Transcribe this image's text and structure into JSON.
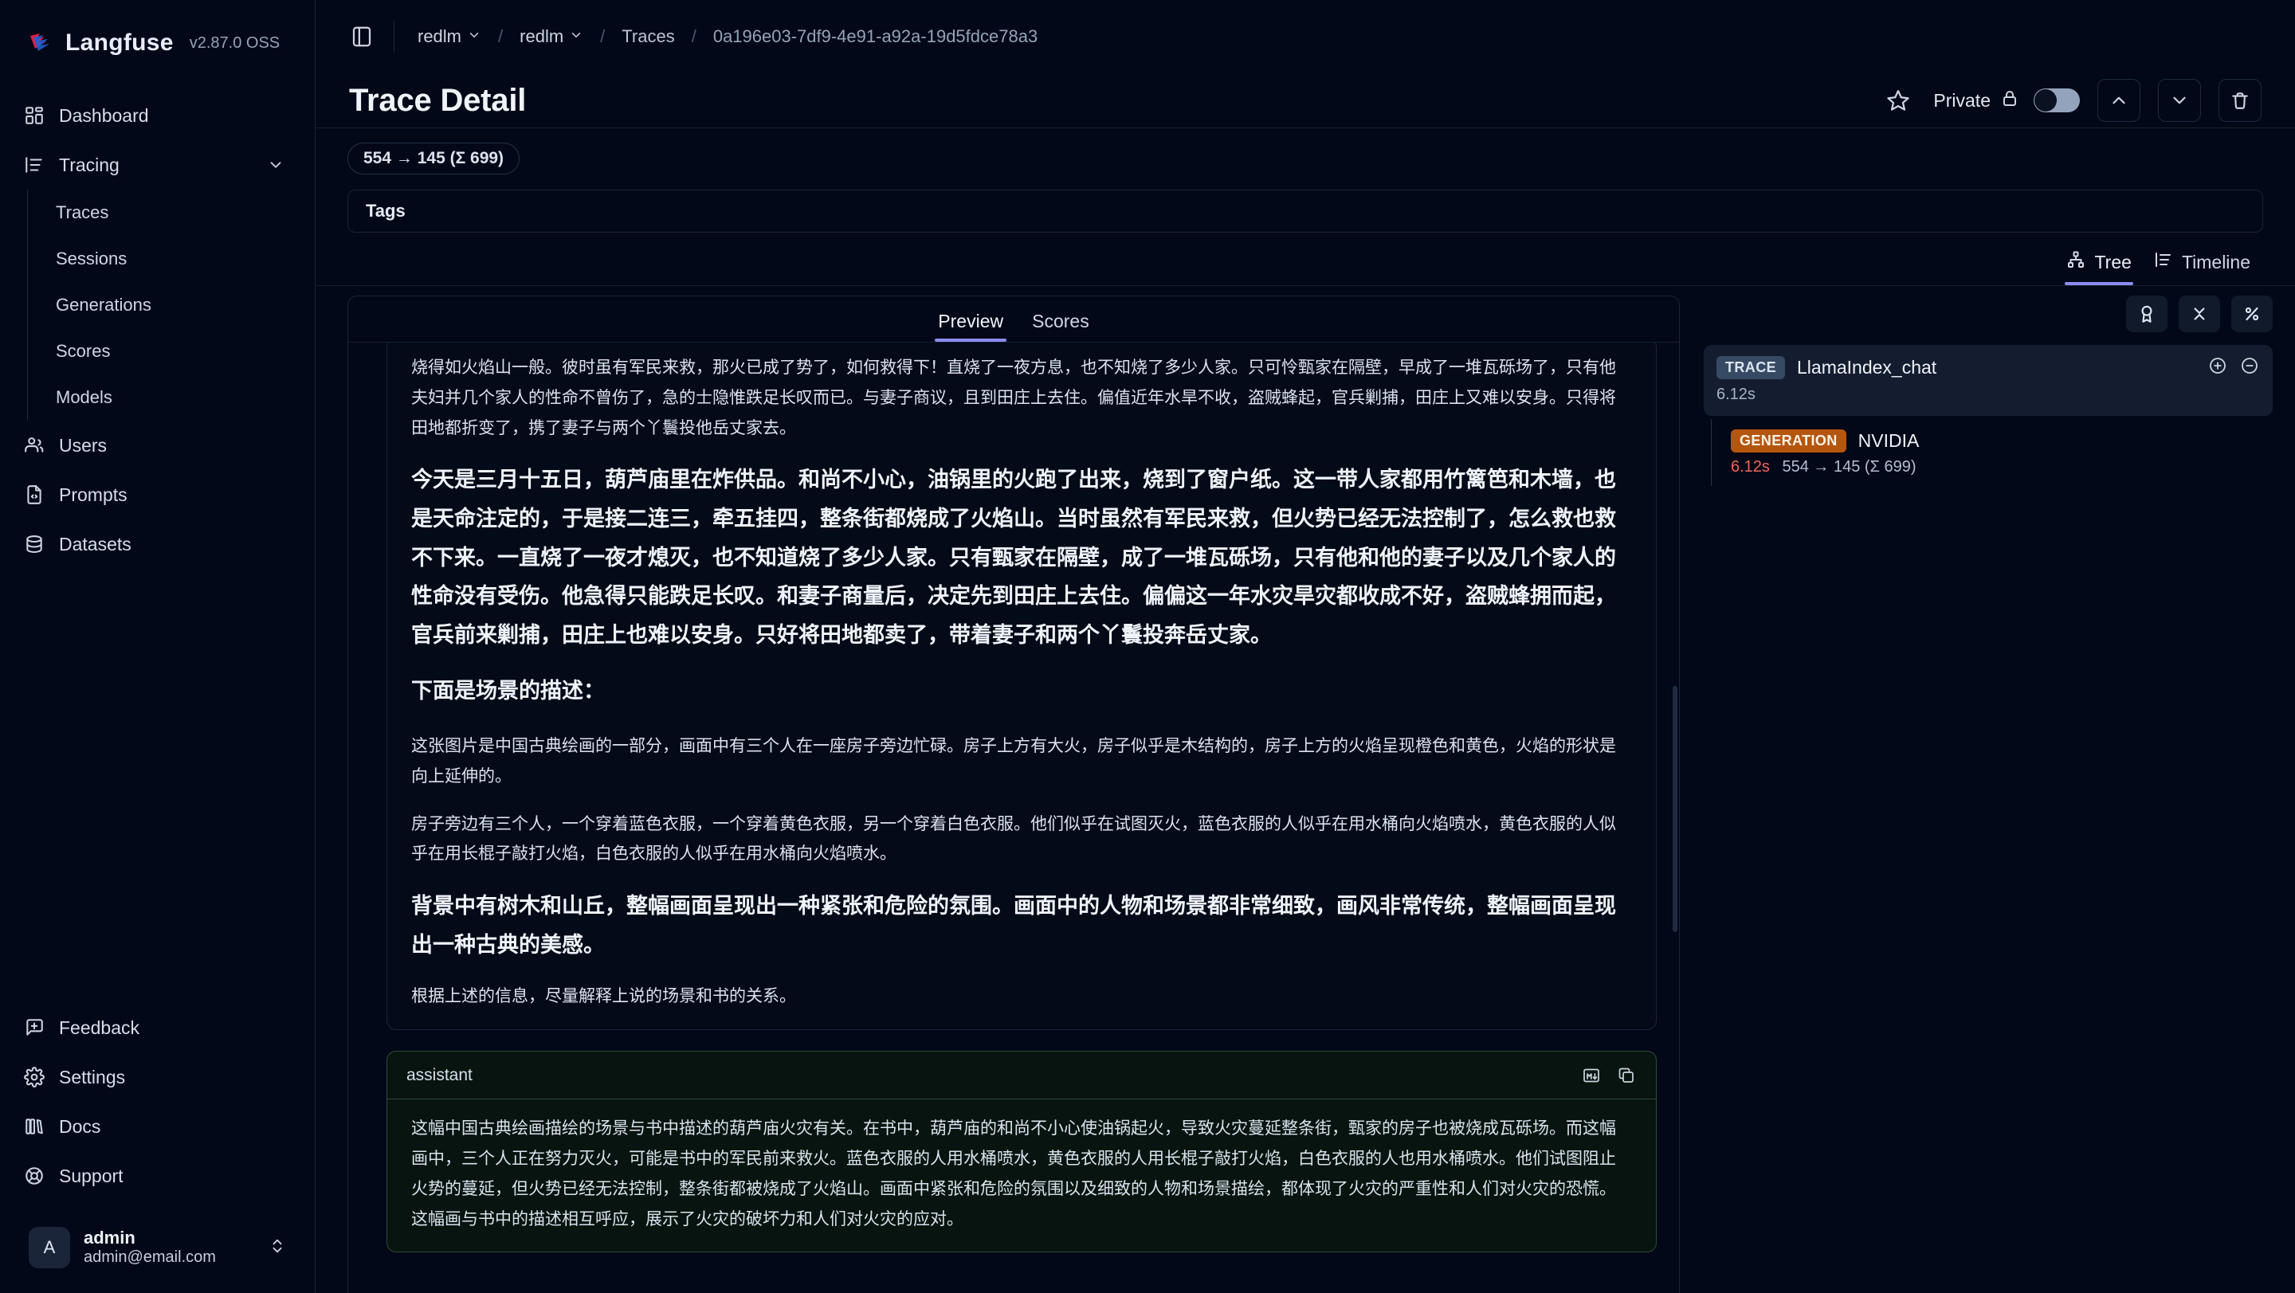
{
  "brand": {
    "name": "Langfuse",
    "version": "v2.87.0 OSS",
    "logo_icon": "langfuse-logo-icon"
  },
  "sidebar": {
    "items": [
      {
        "label": "Dashboard",
        "icon": "dashboard-grid-icon",
        "id": "dashboard"
      },
      {
        "label": "Tracing",
        "icon": "tracing-list-icon",
        "id": "tracing",
        "expandable": true,
        "chevron": "chevron-down-icon"
      },
      {
        "label": "Traces",
        "icon": "",
        "id": "traces",
        "sub": true
      },
      {
        "label": "Sessions",
        "icon": "",
        "id": "sessions",
        "sub": true
      },
      {
        "label": "Generations",
        "icon": "",
        "id": "generations",
        "sub": true
      },
      {
        "label": "Scores",
        "icon": "",
        "id": "scores",
        "sub": true
      },
      {
        "label": "Models",
        "icon": "",
        "id": "models",
        "sub": true
      },
      {
        "label": "Users",
        "icon": "users-icon",
        "id": "users"
      },
      {
        "label": "Prompts",
        "icon": "file-code-icon",
        "id": "prompts"
      },
      {
        "label": "Datasets",
        "icon": "database-icon",
        "id": "datasets"
      }
    ],
    "bottom_items": [
      {
        "label": "Feedback",
        "icon": "message-plus-icon",
        "id": "feedback"
      },
      {
        "label": "Settings",
        "icon": "gear-icon",
        "id": "settings"
      },
      {
        "label": "Docs",
        "icon": "books-icon",
        "id": "docs"
      },
      {
        "label": "Support",
        "icon": "lifebuoy-icon",
        "id": "support"
      }
    ],
    "user": {
      "initial": "A",
      "name": "admin",
      "email": "admin@email.com",
      "switch_icon": "chevrons-up-down-icon"
    }
  },
  "topbar": {
    "panel_toggle_icon": "panel-left-icon",
    "breadcrumbs": [
      {
        "label": "redlm",
        "type": "select",
        "icon": "chevron-down-icon"
      },
      {
        "label": "redlm",
        "type": "select",
        "icon": "chevron-down-icon"
      },
      {
        "label": "Traces",
        "type": "link"
      },
      {
        "label": "0a196e03-7df9-4e91-a92a-19d5fdce78a3",
        "type": "id"
      }
    ],
    "separator": "/"
  },
  "header": {
    "title": "Trace Detail",
    "star_icon": "star-icon",
    "privacy_label": "Private",
    "privacy_icon": "lock-icon",
    "privacy_toggle_on": false,
    "prev_icon": "chevron-up-icon",
    "next_icon": "chevron-down-icon",
    "delete_icon": "trash-icon"
  },
  "meta": {
    "token_badge": "554 → 145 (Σ 699)",
    "tags_label": "Tags"
  },
  "view_tabs": [
    {
      "label": "Tree",
      "icon": "tree-icon",
      "active": true
    },
    {
      "label": "Timeline",
      "icon": "timeline-icon",
      "active": false
    }
  ],
  "detail_tabs": [
    {
      "label": "Preview",
      "active": true
    },
    {
      "label": "Scores",
      "active": false
    }
  ],
  "messages": [
    {
      "role": "",
      "show_head": false,
      "blocks": [
        {
          "style": "normal",
          "text": "烧得如火焰山一般。彼时虽有军民来救，那火已成了势了，如何救得下！直烧了一夜方息，也不知烧了多少人家。只可怜甄家在隔壁，早成了一堆瓦砾场了，只有他夫妇并几个家人的性命不曾伤了，急的士隐惟跌足长叹而已。与妻子商议，且到田庄上去住。偏值近年水旱不收，盗贼蜂起，官兵剿捕，田庄上又难以安身。只得将田地都折变了，携了妻子与两个丫鬟投他岳丈家去。"
        },
        {
          "style": "bold",
          "text": "今天是三月十五日，葫芦庙里在炸供品。和尚不小心，油锅里的火跑了出来，烧到了窗户纸。这一带人家都用竹篱笆和木墙，也是天命注定的，于是接二连三，牵五挂四，整条街都烧成了火焰山。当时虽然有军民来救，但火势已经无法控制了，怎么救也救不下来。一直烧了一夜才熄灭，也不知道烧了多少人家。只有甄家在隔壁，成了一堆瓦砾场，只有他和他的妻子以及几个家人的性命没有受伤。他急得只能跌足长叹。和妻子商量后，决定先到田庄上去住。偏偏这一年水灾旱灾都收成不好，盗贼蜂拥而起，官兵前来剿捕，田庄上也难以安身。只好将田地都卖了，带着妻子和两个丫鬟投奔岳丈家。"
        },
        {
          "style": "heading",
          "text": "下面是场景的描述："
        },
        {
          "style": "normal",
          "text": "这张图片是中国古典绘画的一部分，画面中有三个人在一座房子旁边忙碌。房子上方有大火，房子似乎是木结构的，房子上方的火焰呈现橙色和黄色，火焰的形状是向上延伸的。"
        },
        {
          "style": "normal",
          "text": "房子旁边有三个人，一个穿着蓝色衣服，一个穿着黄色衣服，另一个穿着白色衣服。他们似乎在试图灭火，蓝色衣服的人似乎在用水桶向火焰喷水，黄色衣服的人似乎在用长棍子敲打火焰，白色衣服的人似乎在用水桶向火焰喷水。"
        },
        {
          "style": "bold",
          "text": "背景中有树木和山丘，整幅画面呈现出一种紧张和危险的氛围。画面中的人物和场景都非常细致，画风非常传统，整幅画面呈现出一种古典的美感。"
        },
        {
          "style": "normal",
          "text": "根据上述的信息，尽量解释上说的场景和书的关系。"
        }
      ]
    },
    {
      "role": "assistant",
      "show_head": true,
      "markdown_icon": "markdown-icon",
      "copy_icon": "copy-icon",
      "blocks": [
        {
          "style": "normal",
          "text": "这幅中国古典绘画描绘的场景与书中描述的葫芦庙火灾有关。在书中，葫芦庙的和尚不小心使油锅起火，导致火灾蔓延整条街，甄家的房子也被烧成瓦砾场。而这幅画中，三个人正在努力灭火，可能是书中的军民前来救火。蓝色衣服的人用水桶喷水，黄色衣服的人用长棍子敲打火焰，白色衣服的人也用水桶喷水。他们试图阻止火势的蔓延，但火势已经无法控制，整条街都被烧成了火焰山。画面中紧张和危险的氛围以及细致的人物和场景描绘，都体现了火灾的严重性和人们对火灾的恐慌。这幅画与书中的描述相互呼应，展示了火灾的破坏力和人们对火灾的应对。"
        }
      ]
    }
  ],
  "tree_panel": {
    "tools": [
      {
        "icon": "award-icon",
        "name": "scores-toggle"
      },
      {
        "icon": "collapse-icon",
        "name": "collapse-all"
      },
      {
        "icon": "percent-icon",
        "name": "percent-toggle"
      }
    ],
    "root": {
      "chip": "TRACE",
      "name": "LlamaIndex_chat",
      "duration": "6.12s",
      "expand_icon": "plus-circle-icon",
      "collapse_icon": "minus-circle-icon"
    },
    "children": [
      {
        "chip": "GENERATION",
        "name": "NVIDIA",
        "duration": "6.12s",
        "tokens": "554 → 145 (Σ 699)"
      }
    ]
  },
  "colors": {
    "accent": "#8b8bf0",
    "generation_chip": "#b5560f",
    "trace_chip": "#374a63",
    "duration_red": "#f2665a",
    "background": "#020817",
    "assistant_border": "#2d4d38"
  }
}
